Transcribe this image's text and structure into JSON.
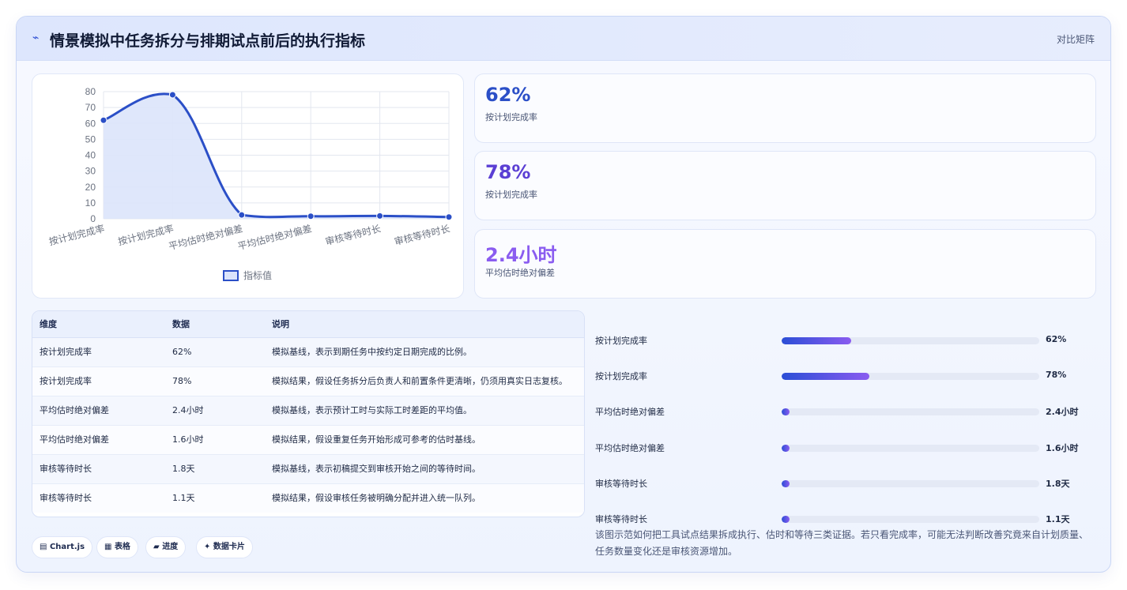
{
  "header": {
    "logo_icon": "zigzag-icon",
    "logo_glyph": "⌁",
    "title": "情景模拟中任务拆分与排期试点前后的执行指标",
    "tag": "对比矩阵"
  },
  "chart_data": {
    "type": "line",
    "categories": [
      "按计划完成率",
      "按计划完成率",
      "平均估时绝对偏差",
      "平均估时绝对偏差",
      "审核等待时长",
      "审核等待时长"
    ],
    "series": [
      {
        "name": "指标值",
        "values": [
          62,
          78,
          2.4,
          1.6,
          1.8,
          1.1
        ]
      }
    ],
    "ylim": [
      0,
      80
    ],
    "yticks": [
      0,
      10,
      20,
      30,
      40,
      50,
      60,
      70,
      80
    ],
    "grid": true,
    "fill": true,
    "legend": "bottom",
    "color": "#2b4fc7",
    "fill_color": "#dbe4fb"
  },
  "kpis": [
    {
      "value": "62%",
      "label": "按计划完成率",
      "color": "#2b4fc7"
    },
    {
      "value": "78%",
      "label": "按计划完成率",
      "color": "#5b3fd4"
    },
    {
      "value": "2.4小时",
      "label": "平均估时绝对偏差",
      "color": "#8a5cf0"
    }
  ],
  "table": {
    "headers": [
      "维度",
      "数据",
      "说明"
    ],
    "rows": [
      [
        "按计划完成率",
        "62%",
        "模拟基线，表示到期任务中按约定日期完成的比例。"
      ],
      [
        "按计划完成率",
        "78%",
        "模拟结果，假设任务拆分后负责人和前置条件更清晰，仍须用真实日志复核。"
      ],
      [
        "平均估时绝对偏差",
        "2.4小时",
        "模拟基线，表示预计工时与实际工时差距的平均值。"
      ],
      [
        "平均估时绝对偏差",
        "1.6小时",
        "模拟结果，假设重复任务开始形成可参考的估时基线。"
      ],
      [
        "审核等待时长",
        "1.8天",
        "模拟基线，表示初稿提交到审核开始之间的等待时间。"
      ],
      [
        "审核等待时长",
        "1.1天",
        "模拟结果，假设审核任务被明确分配并进入统一队列。"
      ]
    ]
  },
  "progress": {
    "items": [
      {
        "label": "按计划完成率",
        "value": "62%",
        "fraction": 0.27
      },
      {
        "label": "按计划完成率",
        "value": "78%",
        "fraction": 0.34
      },
      {
        "label": "平均估时绝对偏差",
        "value": "2.4小时",
        "fraction": 0.02
      },
      {
        "label": "平均估时绝对偏差",
        "value": "1.6小时",
        "fraction": 0.02
      },
      {
        "label": "审核等待时长",
        "value": "1.8天",
        "fraction": 0.02
      },
      {
        "label": "审核等待时长",
        "value": "1.1天",
        "fraction": 0.02
      }
    ]
  },
  "chips": [
    {
      "icon": "chart-icon",
      "glyph": "▤",
      "label": "Chart.js"
    },
    {
      "icon": "table-icon",
      "glyph": "▦",
      "label": "表格"
    },
    {
      "icon": "progress-icon",
      "glyph": "▰",
      "label": "进度"
    },
    {
      "icon": "sparkle-icon",
      "glyph": "✦",
      "label": "数据卡片"
    }
  ],
  "note": "该图示范如何把工具试点结果拆成执行、估时和等待三类证据。若只看完成率，可能无法判断改善究竟来自计划质量、任务数量变化还是审核资源增加。"
}
